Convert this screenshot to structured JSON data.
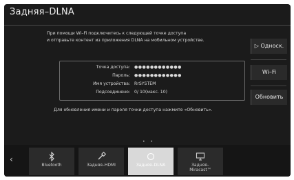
{
  "header": {
    "title": "Задняя–DLNA"
  },
  "description": {
    "line1": "При помощи Wi–Fi подключитесь к следующей точке доступа",
    "line2": "и отправьте контент из приложения DLNA на мобильном устройстве."
  },
  "info": {
    "rows": [
      {
        "label": "Точка доступа:",
        "value": "●●●●●●●●●●●●"
      },
      {
        "label": "Пароль:",
        "value": "●●●●●●●●●●●●"
      },
      {
        "label": "Имя устройства:",
        "value": "RrSYSTEM"
      },
      {
        "label": "Подсоединено:",
        "value": "0/ 10(макс. 10)"
      }
    ]
  },
  "note": "Для обновления имени и пароля точки доступа нажмите «Обновить».",
  "side_buttons": {
    "source": "▷ Односк.",
    "wifi": "Wi–Fi",
    "refresh": "Обновить"
  },
  "pager": {
    "dots": "• •"
  },
  "tray": {
    "back": "‹",
    "tiles": [
      {
        "label": "Bluetooth",
        "icon": "bluetooth-icon",
        "active": false
      },
      {
        "label": "Задняя–HDMI",
        "icon": "hdmi-cable-icon",
        "active": false
      },
      {
        "label": "Задняя–DLNA",
        "icon": "dlna-icon",
        "active": true
      },
      {
        "label": "Задняя–\nMiracast™",
        "icon": "miracast-icon",
        "active": false
      }
    ]
  }
}
